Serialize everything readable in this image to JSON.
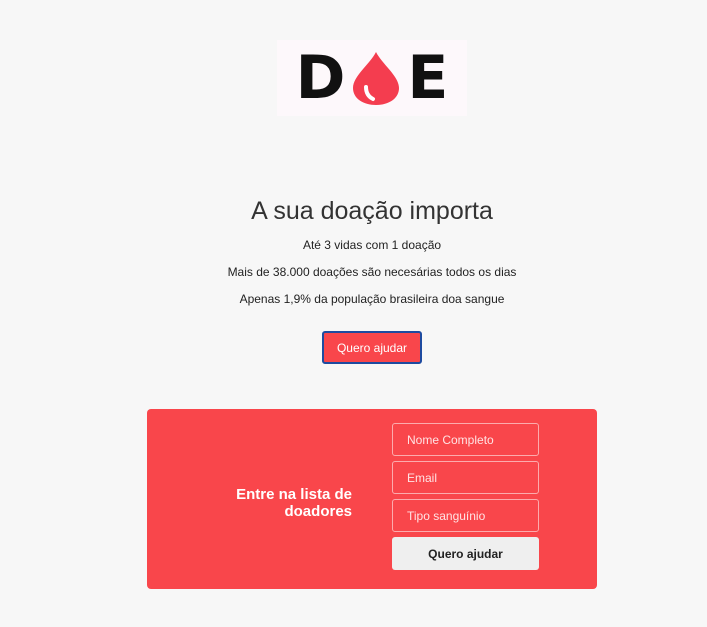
{
  "logo": {
    "letter_left": "D",
    "letter_right": "E",
    "drop_icon": "blood-drop-icon",
    "drop_color": "#f43d4f"
  },
  "hero": {
    "title": "A sua doação importa",
    "line1": "Até 3 vidas com 1 doação",
    "line2": "Mais de 38.000 doações são necesárias todos os dias",
    "line3": "Apenas 1,9% da população brasileira doa sangue",
    "cta_label": "Quero ajudar"
  },
  "signup": {
    "title": "Entre na lista de doadores",
    "name_placeholder": "Nome Completo",
    "email_placeholder": "Email",
    "blood_type_placeholder": "Tipo sanguínio",
    "submit_label": "Quero ajudar"
  },
  "colors": {
    "accent": "#f9464b",
    "background": "#f7f7f7",
    "cta_border": "#1e4ba0"
  }
}
